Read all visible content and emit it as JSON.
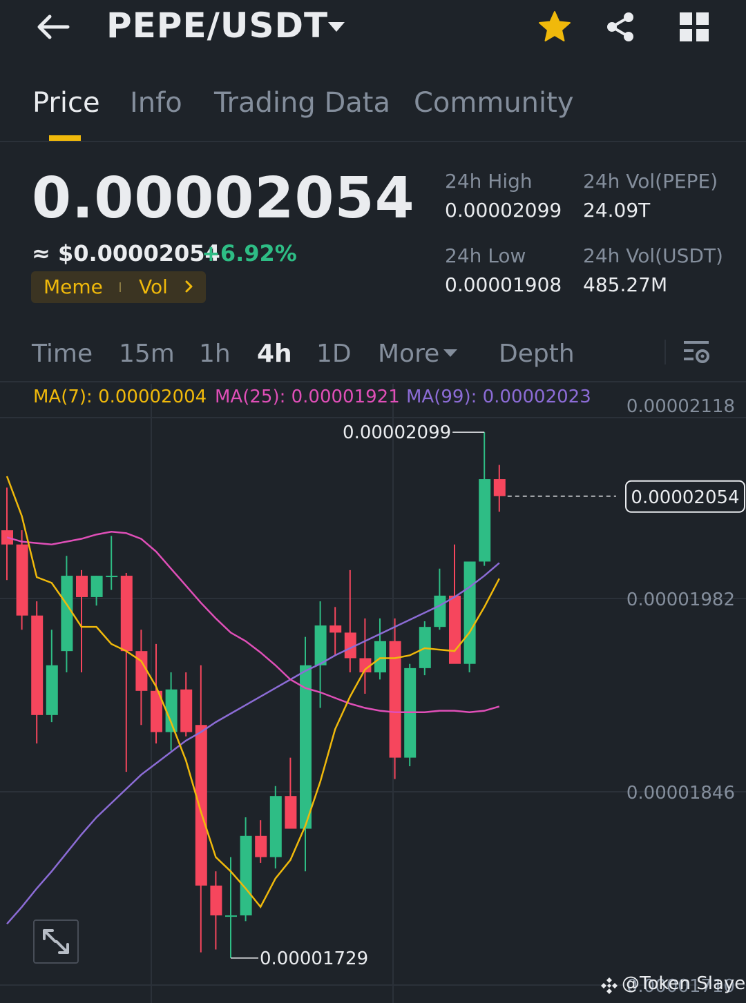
{
  "header": {
    "pair": "PEPE/USDT",
    "icons": [
      "back-arrow-icon",
      "caret-down-icon",
      "star-icon",
      "share-icon",
      "grid-icon"
    ],
    "star_color": "#f0b90b"
  },
  "tabs": [
    {
      "label": "Price",
      "active": true
    },
    {
      "label": "Info",
      "active": false
    },
    {
      "label": "Trading Data",
      "active": false
    },
    {
      "label": "Community",
      "active": false
    }
  ],
  "ticker": {
    "last_price": "0.00002054",
    "usd_price": "≈ $0.00002054",
    "change": "+6.92%",
    "tag_meme": "Meme",
    "tag_vol": "Vol",
    "high_label": "24h High",
    "high_value": "0.00002099",
    "low_label": "24h Low",
    "low_value": "0.00001908",
    "vol_pepe_label": "24h Vol(PEPE)",
    "vol_pepe_value": "24.09T",
    "vol_usdt_label": "24h Vol(USDT)",
    "vol_usdt_value": "485.27M"
  },
  "intervals": {
    "items": [
      "Time",
      "15m",
      "1h",
      "4h",
      "1D",
      "More",
      "Depth"
    ],
    "active": "4h"
  },
  "indicators": {
    "ma7": "MA(7): 0.00002004",
    "ma25": "MA(25): 0.00001921",
    "ma99": "MA(99): 0.00002023"
  },
  "colors": {
    "up": "#2ebd85",
    "down": "#f6465d",
    "ma7": "#f0b90b",
    "ma25": "#e04fb8",
    "ma99": "#8c6cd6",
    "accent": "#f0b90b"
  },
  "chart_data": {
    "type": "candlestick",
    "y_ticks": [
      "0.00002118",
      "0.00001982",
      "0.00001846",
      "0.00001710"
    ],
    "ylim": [
      1.69e-05,
      2.12e-05
    ],
    "high_marker": "0.00002099",
    "low_marker": "0.00001729",
    "last_price_marker": "0.00002054",
    "candles": [
      {
        "o": 2.03e-05,
        "h": 2.06e-05,
        "l": 1.995e-05,
        "c": 2.02e-05
      },
      {
        "o": 2.02e-05,
        "h": 2.03e-05,
        "l": 1.96e-05,
        "c": 1.97e-05
      },
      {
        "o": 1.97e-05,
        "h": 1.98e-05,
        "l": 1.88e-05,
        "c": 1.9e-05
      },
      {
        "o": 1.9e-05,
        "h": 1.96e-05,
        "l": 1.895e-05,
        "c": 1.935e-05
      },
      {
        "o": 1.945e-05,
        "h": 2.012e-05,
        "l": 1.93e-05,
        "c": 1.998e-05
      },
      {
        "o": 1.998e-05,
        "h": 2.002e-05,
        "l": 1.93e-05,
        "c": 1.983e-05
      },
      {
        "o": 1.983e-05,
        "h": 1.998e-05,
        "l": 1.977e-05,
        "c": 1.998e-05
      },
      {
        "o": 1.998e-05,
        "h": 2.026e-05,
        "l": 1.988e-05,
        "c": 1.998e-05
      },
      {
        "o": 1.998e-05,
        "h": 2e-05,
        "l": 1.86e-05,
        "c": 1.945e-05
      },
      {
        "o": 1.945e-05,
        "h": 1.96e-05,
        "l": 1.893e-05,
        "c": 1.917e-05
      },
      {
        "o": 1.917e-05,
        "h": 1.95e-05,
        "l": 1.88e-05,
        "c": 1.888e-05
      },
      {
        "o": 1.888e-05,
        "h": 1.93e-05,
        "l": 1.875e-05,
        "c": 1.918e-05
      },
      {
        "o": 1.918e-05,
        "h": 1.93e-05,
        "l": 1.885e-05,
        "c": 1.888e-05
      },
      {
        "o": 1.893e-05,
        "h": 1.935e-05,
        "l": 1.733e-05,
        "c": 1.78e-05
      },
      {
        "o": 1.78e-05,
        "h": 1.79e-05,
        "l": 1.735e-05,
        "c": 1.759e-05
      },
      {
        "o": 1.759e-05,
        "h": 1.8e-05,
        "l": 1.729e-05,
        "c": 1.759e-05
      },
      {
        "o": 1.759e-05,
        "h": 1.828e-05,
        "l": 1.755e-05,
        "c": 1.815e-05
      },
      {
        "o": 1.815e-05,
        "h": 1.826e-05,
        "l": 1.796e-05,
        "c": 1.8e-05
      },
      {
        "o": 1.8e-05,
        "h": 1.85e-05,
        "l": 1.792e-05,
        "c": 1.843e-05
      },
      {
        "o": 1.843e-05,
        "h": 1.87e-05,
        "l": 1.82e-05,
        "c": 1.82e-05
      },
      {
        "o": 1.82e-05,
        "h": 1.955e-05,
        "l": 1.79e-05,
        "c": 1.935e-05
      },
      {
        "o": 1.935e-05,
        "h": 1.98e-05,
        "l": 1.905e-05,
        "c": 1.963e-05
      },
      {
        "o": 1.963e-05,
        "h": 1.976e-05,
        "l": 1.942e-05,
        "c": 1.958e-05
      },
      {
        "o": 1.958e-05,
        "h": 2.002e-05,
        "l": 1.93e-05,
        "c": 1.94e-05
      },
      {
        "o": 1.94e-05,
        "h": 1.968e-05,
        "l": 1.915e-05,
        "c": 1.93e-05
      },
      {
        "o": 1.93e-05,
        "h": 1.968e-05,
        "l": 1.925e-05,
        "c": 1.952e-05
      },
      {
        "o": 1.952e-05,
        "h": 1.968e-05,
        "l": 1.855e-05,
        "c": 1.87e-05
      },
      {
        "o": 1.87e-05,
        "h": 1.936e-05,
        "l": 1.864e-05,
        "c": 1.933e-05
      },
      {
        "o": 1.933e-05,
        "h": 1.966e-05,
        "l": 1.928e-05,
        "c": 1.962e-05
      },
      {
        "o": 1.962e-05,
        "h": 2.003e-05,
        "l": 1.96e-05,
        "c": 1.984e-05
      },
      {
        "o": 1.984e-05,
        "h": 2.02e-05,
        "l": 1.96e-05,
        "c": 1.936e-05
      },
      {
        "o": 1.936e-05,
        "h": 2.008e-05,
        "l": 1.93e-05,
        "c": 2.008e-05
      },
      {
        "o": 2.008e-05,
        "h": 2.099e-05,
        "l": 2.005e-05,
        "c": 2.066e-05
      },
      {
        "o": 2.066e-05,
        "h": 2.076e-05,
        "l": 2.043e-05,
        "c": 2.054e-05
      }
    ],
    "ma7": [
      2.068e-05,
      2.04e-05,
      1.997e-05,
      1.993e-05,
      1.978e-05,
      1.962e-05,
      1.962e-05,
      1.95e-05,
      1.945e-05,
      1.938e-05,
      1.92e-05,
      1.895e-05,
      1.868e-05,
      1.832e-05,
      1.8e-05,
      1.79e-05,
      1.778e-05,
      1.765e-05,
      1.785e-05,
      1.798e-05,
      1.822e-05,
      1.853e-05,
      1.89e-05,
      1.913e-05,
      1.932e-05,
      1.94e-05,
      1.94e-05,
      1.942e-05,
      1.947e-05,
      1.946e-05,
      1.945e-05,
      1.958e-05,
      1.976e-05,
      1.996e-05
    ],
    "ma25": [
      2.025e-05,
      2.022e-05,
      2.021e-05,
      2.02e-05,
      2.022e-05,
      2.024e-05,
      2.027e-05,
      2.029e-05,
      2.028e-05,
      2.024e-05,
      2.015e-05,
      2.003e-05,
      1.991e-05,
      1.979e-05,
      1.968e-05,
      1.958e-05,
      1.952e-05,
      1.944e-05,
      1.935e-05,
      1.925e-05,
      1.919e-05,
      1.916e-05,
      1.912e-05,
      1.908e-05,
      1.905e-05,
      1.903e-05,
      1.902e-05,
      1.902e-05,
      1.902e-05,
      1.903e-05,
      1.903e-05,
      1.902e-05,
      1.903e-05,
      1.906e-05
    ],
    "ma99": [
      1.753e-05,
      1.765e-05,
      1.778e-05,
      1.79e-05,
      1.803e-05,
      1.816e-05,
      1.828e-05,
      1.838e-05,
      1.848e-05,
      1.858e-05,
      1.866e-05,
      1.874e-05,
      1.882e-05,
      1.888e-05,
      1.895e-05,
      1.901e-05,
      1.907e-05,
      1.913e-05,
      1.919e-05,
      1.925e-05,
      1.931e-05,
      1.936e-05,
      1.942e-05,
      1.947e-05,
      1.952e-05,
      1.957e-05,
      1.962e-05,
      1.967e-05,
      1.972e-05,
      1.977e-05,
      1.983e-05,
      1.99e-05,
      1.998e-05,
      2.007e-05
    ]
  },
  "watermark": "@Token Slayer"
}
